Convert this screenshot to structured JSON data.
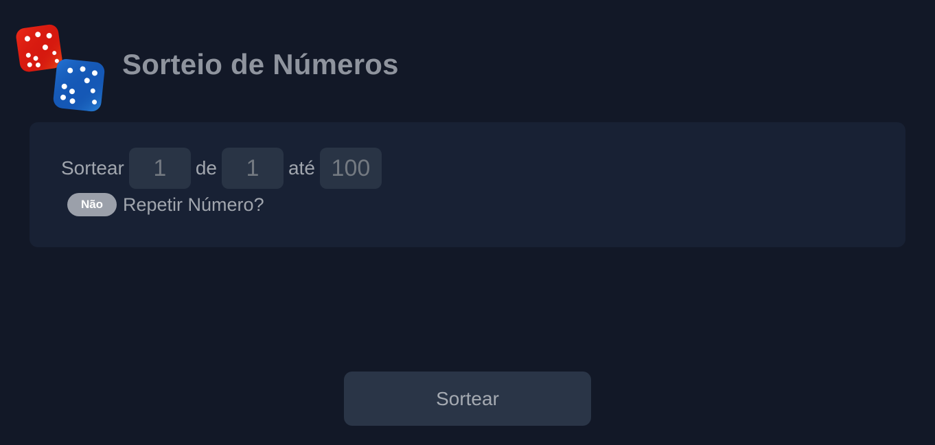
{
  "header": {
    "title": "Sorteio de Números",
    "logo_icon": "dice-icon"
  },
  "form": {
    "label_sortear": "Sortear",
    "quantity_placeholder": "1",
    "label_de": "de",
    "min_placeholder": "1",
    "label_ate": "até",
    "max_placeholder": "100",
    "repeat_toggle_label": "Não",
    "repeat_label": "Repetir Número?"
  },
  "actions": {
    "draw_label": "Sortear"
  },
  "colors": {
    "background": "#121827",
    "card": "#182134",
    "input": "#293445",
    "toggle": "#9ba0aa",
    "button": "#2a3547",
    "red_die": "#e0241a",
    "blue_die": "#1b66c9"
  }
}
